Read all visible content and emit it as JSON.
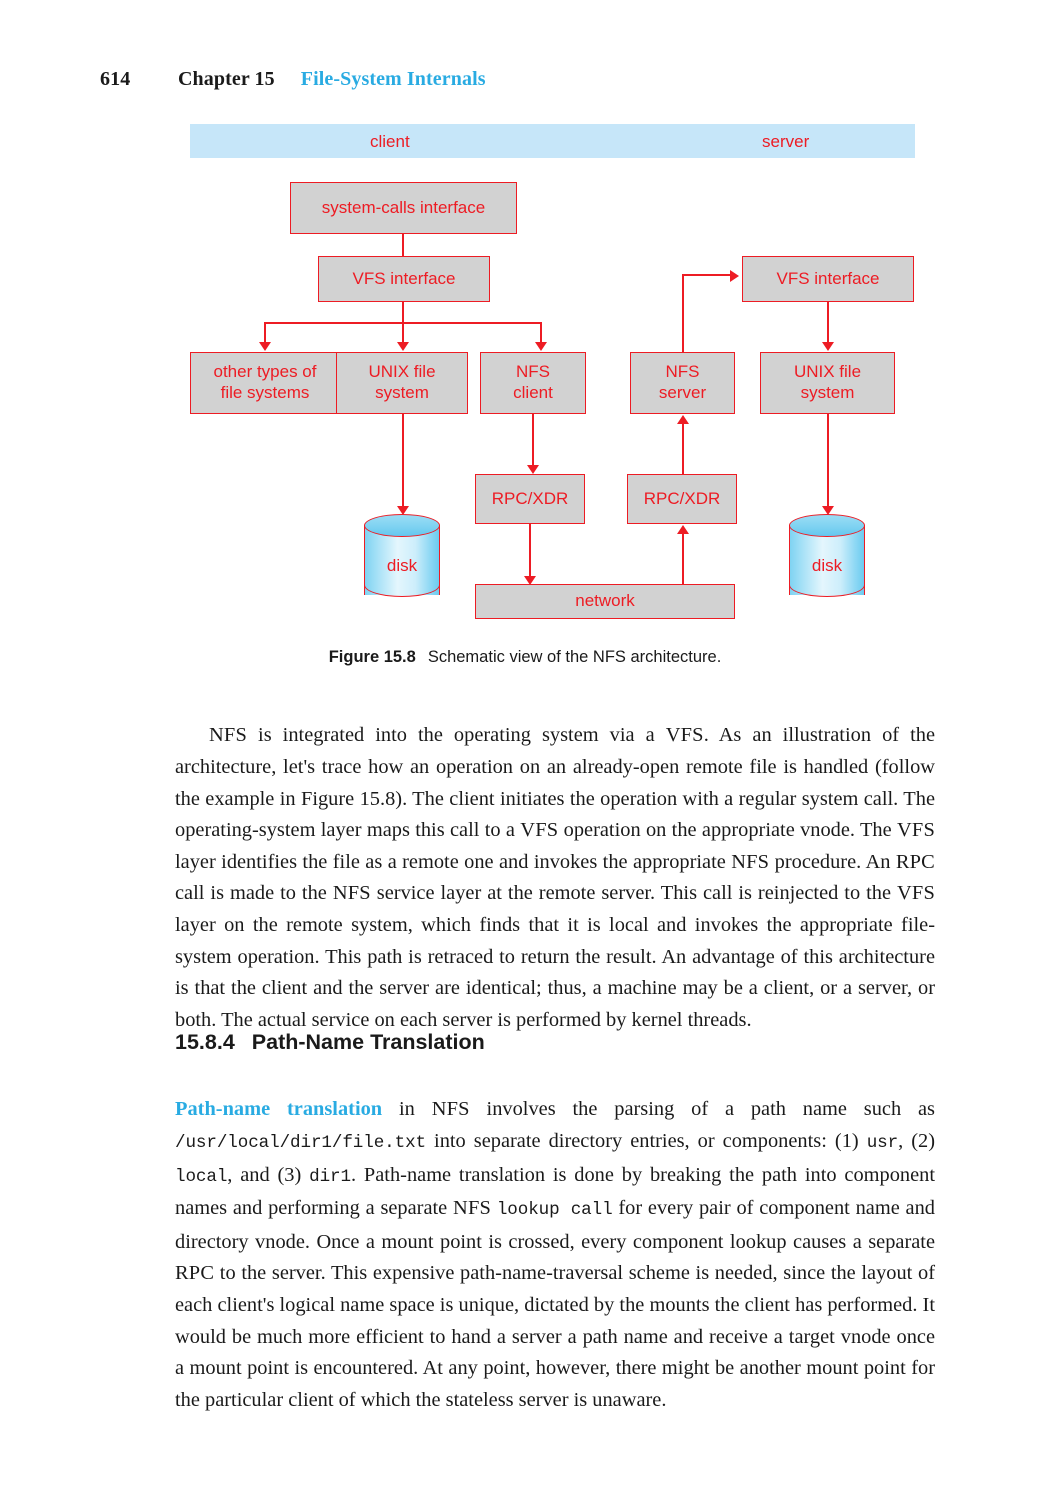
{
  "page": {
    "folio": "614",
    "chapter_label": "Chapter 15",
    "chapter_title": "File-System Internals"
  },
  "figure": {
    "band": {
      "client_label": "client",
      "server_label": "server",
      "band_color": "#c6e6f9"
    },
    "box_fill": "#d2d2d2",
    "box_stroke": "#ed1c24",
    "text_color": "#ed1c24",
    "boxes": {
      "system_calls_interface": "system-calls interface",
      "vfs_interface_client": "VFS interface",
      "other_types_of_file_systems": "other types of\nfile systems",
      "other_types_line1": "other types of",
      "other_types_line2": "file systems",
      "unix_file_system_client_line1": "UNIX file",
      "unix_file_system_client_line2": "system",
      "nfs_client_line1": "NFS",
      "nfs_client_line2": "client",
      "nfs_server_line1": "NFS",
      "nfs_server_line2": "server",
      "unix_file_system_server_line1": "UNIX file",
      "unix_file_system_server_line2": "system",
      "vfs_interface_server": "VFS interface",
      "rpc_xdr_client": "RPC/XDR",
      "rpc_xdr_server": "RPC/XDR",
      "network": "network",
      "disk_client": "disk",
      "disk_server": "disk"
    }
  },
  "caption": {
    "label": "Figure 15.8",
    "text": "Schematic view of the NFS architecture."
  },
  "paragraph_1": {
    "p1_a": "NFS",
    "p1_b": " is integrated into the operating system via a ",
    "p1_c": "VFS",
    "p1_d": ". As an illustration of the architecture, let's trace how an operation on an already-open remote file is handled (follow the example in Figure 15.8). The client initiates the operation with a regular system call. The operating-system layer maps this call to a ",
    "p1_e": "VFS",
    "p1_f": " operation on the appropriate vnode. The ",
    "p1_g": "VFS",
    "p1_h": " layer identifies the file as a remote one and invokes the appropriate ",
    "p1_i": "NFS",
    "p1_j": " procedure. An ",
    "p1_k": "RPC",
    "p1_l": " call is made to the ",
    "p1_m": "NFS",
    "p1_n": " service layer at the remote server. This call is reinjected to the ",
    "p1_o": "VFS",
    "p1_p": " layer on the remote system, which finds that it is local and invokes the appropriate file-system operation. This path is retraced to return the result. An advantage of this architecture is that the client and the server are identical; thus, a machine may be a client, or a server, or both. The actual service on each server is performed by kernel threads."
  },
  "section": {
    "number": "15.8.4",
    "title": "Path-Name Translation"
  },
  "paragraph_2": {
    "p2_term": "Path-name translation",
    "p2_a": " in ",
    "p2_b": "NFS",
    "p2_c": " involves the parsing of a path name such as ",
    "p2_path": "/usr/local/dir1/file.txt",
    "p2_d": " into separate directory entries, or components: (1) ",
    "p2_usr": "usr",
    "p2_e": ", (2) ",
    "p2_local": "local",
    "p2_f": ", and (3) ",
    "p2_dir1": "dir1",
    "p2_g": ". Path-name translation is done by breaking the path into component names and performing a separate ",
    "p2_h": "NFS",
    "p2_i": " ",
    "p2_lookup": "lookup call",
    "p2_j": " for every pair of component name and directory vnode. Once a mount point is crossed, every component lookup causes a separate ",
    "p2_k": "RPC",
    "p2_l": " to the server. This expensive path-name-traversal scheme is needed, since the layout of each client's logical name space is unique, dictated by the mounts the client has performed. It would be much more efficient to hand a server a path name and receive a target vnode once a mount point is encountered. At any point, however, there might be another mount point for the particular client of which the stateless server is unaware."
  }
}
